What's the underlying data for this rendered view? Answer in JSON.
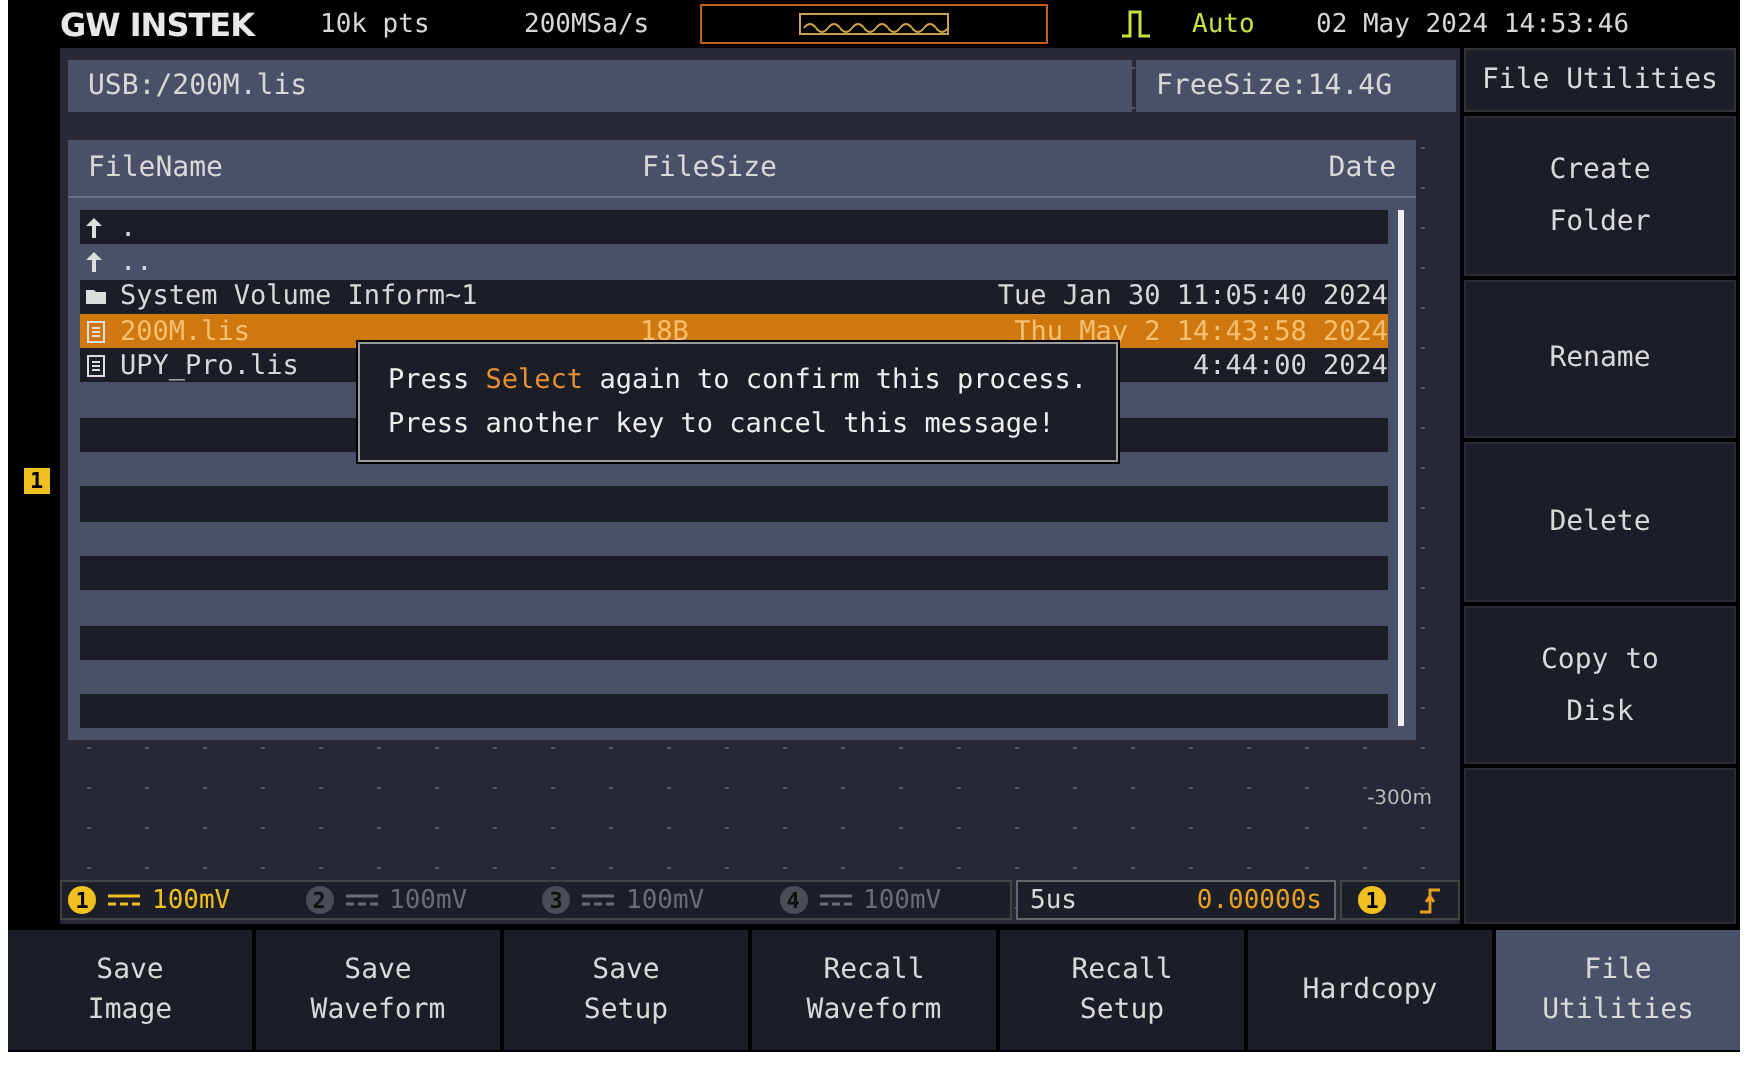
{
  "top_bar": {
    "logo": "GW INSTEK",
    "record_length": "10k pts",
    "sample_rate": "200MSa/s",
    "trigger_mode": "Auto",
    "datetime": "02 May 2024 14:53:46"
  },
  "path_bar": {
    "path": "USB:/200M.lis",
    "free_size": "FreeSize:14.4G"
  },
  "file_table": {
    "columns": [
      "FileName",
      "FileSize",
      "Date"
    ],
    "rows": [
      {
        "kind": "up",
        "name": ".",
        "selected": false
      },
      {
        "kind": "up",
        "name": "..",
        "selected": false
      },
      {
        "kind": "folder",
        "name": "System Volume Inform~1",
        "date": "Tue Jan 30 11:05:40 2024",
        "selected": false
      },
      {
        "kind": "file",
        "name": "200M.lis",
        "size": "18B",
        "date": "Thu May  2 14:43:58 2024",
        "selected": true
      },
      {
        "kind": "file",
        "name": "UPY_Pro.lis",
        "date": "4:44:00 2024",
        "selected": false
      }
    ]
  },
  "dialog": {
    "lines": [
      [
        {
          "text": "Press "
        },
        {
          "text": "Select",
          "highlight": true
        },
        {
          "text": " again to confirm this process."
        }
      ],
      [
        {
          "text": "Press another key to cancel this message!"
        }
      ]
    ]
  },
  "channel_marker": "1",
  "scale_label": "-300m",
  "status_bar": {
    "channels": [
      {
        "number": "1",
        "volts": "100mV",
        "enabled": true
      },
      {
        "number": "2",
        "volts": "100mV",
        "enabled": false
      },
      {
        "number": "3",
        "volts": "100mV",
        "enabled": false
      },
      {
        "number": "4",
        "volts": "100mV",
        "enabled": false
      }
    ],
    "timebase": "5us",
    "position": "0.00000s",
    "trigger_source": "1"
  },
  "side_menu": {
    "title": "File Utilities",
    "items": [
      [
        "Create",
        "Folder"
      ],
      [
        "Rename"
      ],
      [
        "Delete"
      ],
      [
        "Copy to",
        "Disk"
      ]
    ]
  },
  "bottom_menu": [
    {
      "lines": [
        "Save",
        "Image"
      ],
      "selected": false
    },
    {
      "lines": [
        "Save",
        "Waveform"
      ],
      "selected": false
    },
    {
      "lines": [
        "Save",
        "Setup"
      ],
      "selected": false
    },
    {
      "lines": [
        "Recall",
        "Waveform"
      ],
      "selected": false
    },
    {
      "lines": [
        "Recall",
        "Setup"
      ],
      "selected": false
    },
    {
      "lines": [
        "Hardcopy"
      ],
      "selected": false
    },
    {
      "lines": [
        "File",
        "Utilities"
      ],
      "selected": true
    }
  ]
}
